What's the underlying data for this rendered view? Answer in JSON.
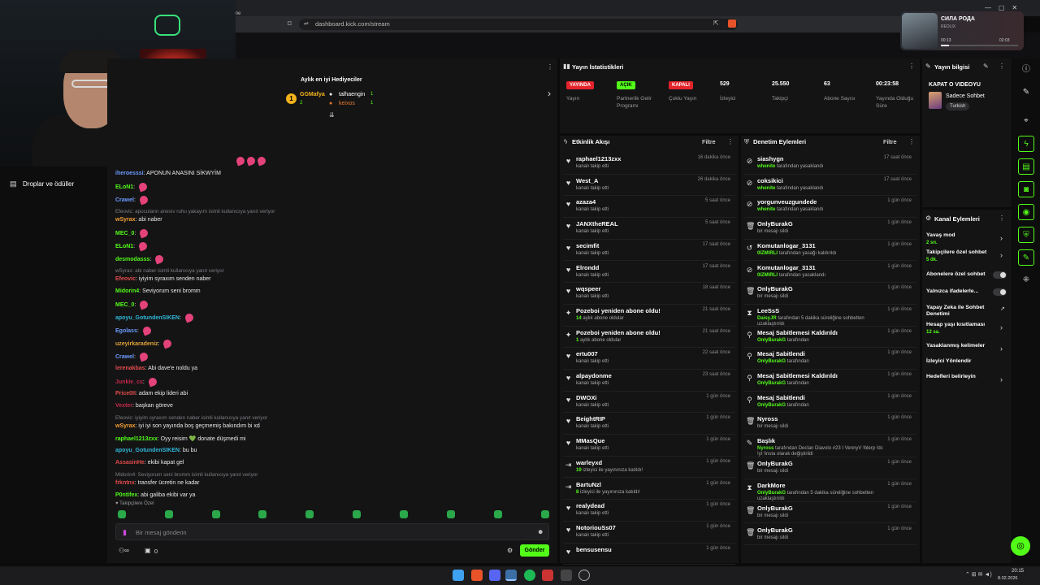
{
  "browser": {
    "url": "dashboard.kick.com/stream",
    "tab_fragment": "me"
  },
  "media": {
    "title": "СИЛА РОДА",
    "artist": "REDLIX",
    "elapsed": "00:13",
    "duration": "02:03"
  },
  "gifters": {
    "title": "Aylık en iyi Hediyeciler",
    "first": {
      "name": "GGMafya",
      "count": "2"
    },
    "second": {
      "name": "talhaengin",
      "count": "1"
    },
    "third": {
      "name": "keixos",
      "count": "1"
    }
  },
  "leftnav": {
    "drops": "Droplar ve ödüller"
  },
  "chat": {
    "placeholder": "Bir mesaj gönderin",
    "send": "Gönder",
    "subonly": "Takipçilere Özel",
    "viewers": "0"
  },
  "chat_lines": [
    {
      "t": "msg",
      "user": "iheroesssi",
      "color": "#6c9cff",
      "text": "APONUN ANASINI SİKWYİM"
    },
    {
      "t": "msg",
      "user": "ELoN1",
      "color": "#53fc18",
      "text": "",
      "emote": true
    },
    {
      "t": "msg",
      "user": "Crawel",
      "color": "#6c9cff",
      "text": "",
      "emote": true
    },
    {
      "t": "reply",
      "text": "Efeovic: apocuların anesiv ruhu yakayım isimli kullanıcıya yanıt veriyor"
    },
    {
      "t": "msg",
      "user": "wSyrax",
      "color": "#f3a034",
      "text": "abi naber"
    },
    {
      "t": "msg",
      "user": "MEC_0",
      "color": "#53fc18",
      "text": "",
      "emote": true
    },
    {
      "t": "msg",
      "user": "ELoN1",
      "color": "#53fc18",
      "text": "",
      "emote": true
    },
    {
      "t": "msg",
      "user": "desmodasss",
      "color": "#53fc18",
      "text": "",
      "emote": true
    },
    {
      "t": "reply",
      "text": "wSyrax: abi naber isimli kullanıcıya yanıt veriyor"
    },
    {
      "t": "msg",
      "user": "Efeovic",
      "color": "#e34b4b",
      "text": "iyiyim syraxım senden naber"
    },
    {
      "t": "msg",
      "user": "Midorin4",
      "color": "#53fc18",
      "text": "Seviyorum seni bromm"
    },
    {
      "t": "msg",
      "user": "MEC_0",
      "color": "#53fc18",
      "text": "",
      "emote": true
    },
    {
      "t": "msg",
      "user": "apoyu_GotundenSIKEN",
      "color": "#2fb6d6",
      "text": "",
      "emote": true
    },
    {
      "t": "msg",
      "user": "Egolass",
      "color": "#6c9cff",
      "text": "",
      "emote": true
    },
    {
      "t": "msg",
      "user": "uzeyirkaradeniz",
      "color": "#e2a33a",
      "text": "",
      "emote": true
    },
    {
      "t": "msg",
      "user": "Crawel",
      "color": "#6c9cff",
      "text": "",
      "emote": true
    },
    {
      "t": "msg",
      "user": "lerenakbas",
      "color": "#e34b4b",
      "text": "Abi dave'e noldu ya"
    },
    {
      "t": "msg",
      "user": "Junkie_cs",
      "color": "#c0284a",
      "text": "",
      "emote": true
    },
    {
      "t": "msg",
      "user": "Price0II",
      "color": "#e34b4b",
      "text": "adam ekip lideri abi"
    },
    {
      "t": "msg",
      "user": "Vexter",
      "color": "#c0284a",
      "text": "başkan göreve"
    },
    {
      "t": "reply",
      "text": "Efeovic: iyiyim syraxım senden naber isimli kullanıcıya yanıt veriyor"
    },
    {
      "t": "msg",
      "user": "wSyrax",
      "color": "#f3a034",
      "text": "iyi iyi son yayında boş geçmemiş bakındım bi xd"
    },
    {
      "t": "msg",
      "user": "raphael1213zxx",
      "color": "#53fc18",
      "text": "Oyy reisim 💚 donate düşmedi mi"
    },
    {
      "t": "msg",
      "user": "apoyu_GotundenSIKEN",
      "color": "#2fb6d6",
      "text": "bu bu"
    },
    {
      "t": "msg",
      "user": "AssasinHe",
      "color": "#e34b4b",
      "text": "ekibi kapat gel"
    },
    {
      "t": "reply",
      "text": "Midorin4: Seviyorum seni bromm isimli kullanıcıya yanıt veriyor"
    },
    {
      "t": "msg",
      "user": "frkntnx",
      "color": "#e34b4b",
      "text": "transfer ücretin ne kadar"
    },
    {
      "t": "msg",
      "user": "P0ntifex",
      "color": "#53fc18",
      "text": "abi galiba ekibi var ya"
    }
  ],
  "stats": {
    "title": "Yayın İstatistikleri",
    "items": [
      {
        "badge": "YAYINDA",
        "badgecolor": "#e3242b",
        "label": "Yayın"
      },
      {
        "badge": "AÇIK",
        "badgecolor": "#53fc18",
        "label": "Partnerlik Gelir Programı"
      },
      {
        "badge": "KAPALI",
        "badgecolor": "#e3242b",
        "label": "Çoklu Yayın"
      },
      {
        "value": "529",
        "label": "İzleyici"
      },
      {
        "value": "25.550",
        "label": "Takipçi"
      },
      {
        "value": "63",
        "label": "Abone Sayısı"
      },
      {
        "value": "00:23:58",
        "label": "Yayında Olduğu Süre"
      }
    ]
  },
  "streaminfo": {
    "title": "Yayın bilgisi",
    "stream_title": "KAPAT O VIDEOYU",
    "category": "Sadece Sohbet",
    "language": "Turkish"
  },
  "activity": {
    "title": "Etkinlik Akışı",
    "filter": "Filtre",
    "rows": [
      {
        "icon": "♥",
        "name": "raphael1213zxx",
        "sub": "kanalı takip etti",
        "time": "16 dakika önce"
      },
      {
        "icon": "♥",
        "name": "West_A",
        "sub": "kanalı takip etti",
        "time": "26 dakika önce"
      },
      {
        "icon": "♥",
        "name": "azaza4",
        "sub": "kanalı takip etti",
        "time": "5 saat önce"
      },
      {
        "icon": "♥",
        "name": "JANXtheREAL",
        "sub": "kanalı takip etti",
        "time": "5 saat önce"
      },
      {
        "icon": "♥",
        "name": "secimfit",
        "sub": "kanalı takip etti",
        "time": "17 saat önce"
      },
      {
        "icon": "♥",
        "name": "Elrondd",
        "sub": "kanalı takip etti",
        "time": "17 saat önce"
      },
      {
        "icon": "♥",
        "name": "wqspeer",
        "sub": "kanalı takip etti",
        "time": "18 saat önce"
      },
      {
        "icon": "✦",
        "name": "Pozeboi yeniden abone oldu!",
        "hl": "14",
        "sub": " aylık abone oldular",
        "time": "21 saat önce"
      },
      {
        "icon": "✦",
        "name": "Pozeboi yeniden abone oldu!",
        "hl": "1",
        "sub": " aylık abone oldular",
        "time": "21 saat önce"
      },
      {
        "icon": "♥",
        "name": "ertu007",
        "sub": "kanalı takip etti",
        "time": "22 saat önce"
      },
      {
        "icon": "♥",
        "name": "alpaydonme",
        "sub": "kanalı takip etti",
        "time": "23 saat önce"
      },
      {
        "icon": "♥",
        "name": "DWOXi",
        "sub": "kanalı takip etti",
        "time": "1 gün önce"
      },
      {
        "icon": "♥",
        "name": "BeightRIP",
        "sub": "kanalı takip etti",
        "time": "1 gün önce"
      },
      {
        "icon": "♥",
        "name": "MMasQue",
        "sub": "kanalı takip etti",
        "time": "1 gün önce"
      },
      {
        "icon": "⇥",
        "name": "warleyxd",
        "hl": "19",
        "sub": " izleyici ile yayınınıza katıldı!",
        "time": "1 gün önce"
      },
      {
        "icon": "⇥",
        "name": "BartuNzl",
        "hl": "8",
        "sub": " izleyici ile yayınınıza katıldı!",
        "time": "1 gün önce"
      },
      {
        "icon": "♥",
        "name": "realydead",
        "sub": "kanalı takip etti",
        "time": "1 gün önce"
      },
      {
        "icon": "♥",
        "name": "NotoriouSs07",
        "sub": "kanalı takip etti",
        "time": "1 gün önce"
      },
      {
        "icon": "♥",
        "name": "bensusensu",
        "sub": "",
        "time": "1 gün önce"
      }
    ]
  },
  "moderation": {
    "title": "Denetim Eylemleri",
    "filter": "Filtre",
    "rows": [
      {
        "icon": "⊘",
        "name": "siashygn",
        "hl": "whenite",
        "sub": " tarafından yasaklandı",
        "time": "17 saat önce"
      },
      {
        "icon": "⊘",
        "name": "coksikici",
        "hl": "whenite",
        "sub": " tarafından yasaklandı",
        "time": "17 saat önce"
      },
      {
        "icon": "⊘",
        "name": "yorgunveuzgundede",
        "hl": "whenite",
        "sub": " tarafından yasaklandı",
        "time": "1 gün önce"
      },
      {
        "icon": "🗑",
        "name": "OnlyBurakG",
        "sub": "bir mesajı sildi",
        "time": "1 gün önce"
      },
      {
        "icon": "↺",
        "name": "Komutanlogar_3131",
        "hl": "0IZMIRLI",
        "sub": " tarafından yasağı kaldırıldı",
        "time": "1 gün önce"
      },
      {
        "icon": "⊘",
        "name": "Komutanlogar_3131",
        "hl": "0IZMIRLI",
        "sub": " tarafından yasaklandı",
        "time": "1 gün önce"
      },
      {
        "icon": "🗑",
        "name": "OnlyBurakG",
        "sub": "bir mesajı sildi",
        "time": "1 gün önce"
      },
      {
        "icon": "⧗",
        "name": "LeeSsS",
        "hl": "DaisyJR",
        "sub": " tarafından 5 dakika süreliğine sohbetten uzaklaştırıldı",
        "time": "1 gün önce"
      },
      {
        "icon": "⚲",
        "name": "Mesaj Sabitlemesi Kaldırıldı",
        "hl": "OnlyBurakG",
        "sub": " tarafından",
        "time": "1 gün önce"
      },
      {
        "icon": "⚲",
        "name": "Mesaj Sabitlendi",
        "hl": "OnlyBurakG",
        "sub": " tarafından",
        "time": "1 gün önce"
      },
      {
        "icon": "⚲",
        "name": "Mesaj Sabitlemesi Kaldırıldı",
        "hl": "OnlyBurakG",
        "sub": " tarafından",
        "time": "1 gün önce"
      },
      {
        "icon": "⚲",
        "name": "Mesaj Sabitlendi",
        "hl": "OnlyBurakG",
        "sub": " tarafından",
        "time": "1 gün önce"
      },
      {
        "icon": "🗑",
        "name": "Nyross",
        "sub": "bir mesajı sildi",
        "time": "1 gün önce"
      },
      {
        "icon": "✎",
        "name": "Başlık",
        "hl": "Nyross",
        "sub": " tarafından Declan Diavolo #23 I VennyV !blerp !dc !yt !insta olarak değiştirildi",
        "time": "1 gün önce",
        "tall": true
      },
      {
        "icon": "🗑",
        "name": "OnlyBurakG",
        "sub": "bir mesajı sildi",
        "time": "1 gün önce"
      },
      {
        "icon": "⧗",
        "name": "DarkMore",
        "hl": "OnlyBurakG",
        "sub": " tarafından 5 dakika süreliğine sohbetten uzaklaştırıldı",
        "time": "1 gün önce",
        "tall": true
      },
      {
        "icon": "🗑",
        "name": "OnlyBurakG",
        "sub": "bir mesajı sildi",
        "time": "1 gün önce"
      },
      {
        "icon": "🗑",
        "name": "OnlyBurakG",
        "sub": "bir mesajı sildi",
        "time": "1 gün önce"
      }
    ]
  },
  "channel": {
    "title": "Kanal Eylemleri",
    "actions": [
      {
        "label": "Yavaş mod",
        "sub": "2 sn.",
        "ctl": "chev"
      },
      {
        "label": "Takipçilere özel sohbet",
        "sub": "5 dk.",
        "ctl": "chev"
      },
      {
        "label": "Abonelere özel sohbet",
        "sub": "",
        "ctl": "toggle"
      },
      {
        "label": "Yalnızca ifadelerle...",
        "sub": "",
        "ctl": "toggle"
      },
      {
        "label": "Yapay Zeka ile Sohbet Denetimi",
        "sub": "",
        "ctl": "ext"
      },
      {
        "label": "Hesap yaşı kısıtlaması",
        "sub": "12 sa.",
        "ctl": "chev"
      },
      {
        "label": "Yasaklanmış kelimeler",
        "sub": "",
        "ctl": "chev"
      },
      {
        "label": "İzleyici Yönlendir",
        "sub": "",
        "ctl": "none"
      },
      {
        "label": "Hedefleri belirleyin",
        "sub": "",
        "ctl": "chev"
      }
    ]
  },
  "taskbar": {
    "time": "20:15",
    "date": "8.02.2026"
  },
  "colors": {
    "accent": "#53fc18",
    "live": "#e3242b"
  }
}
